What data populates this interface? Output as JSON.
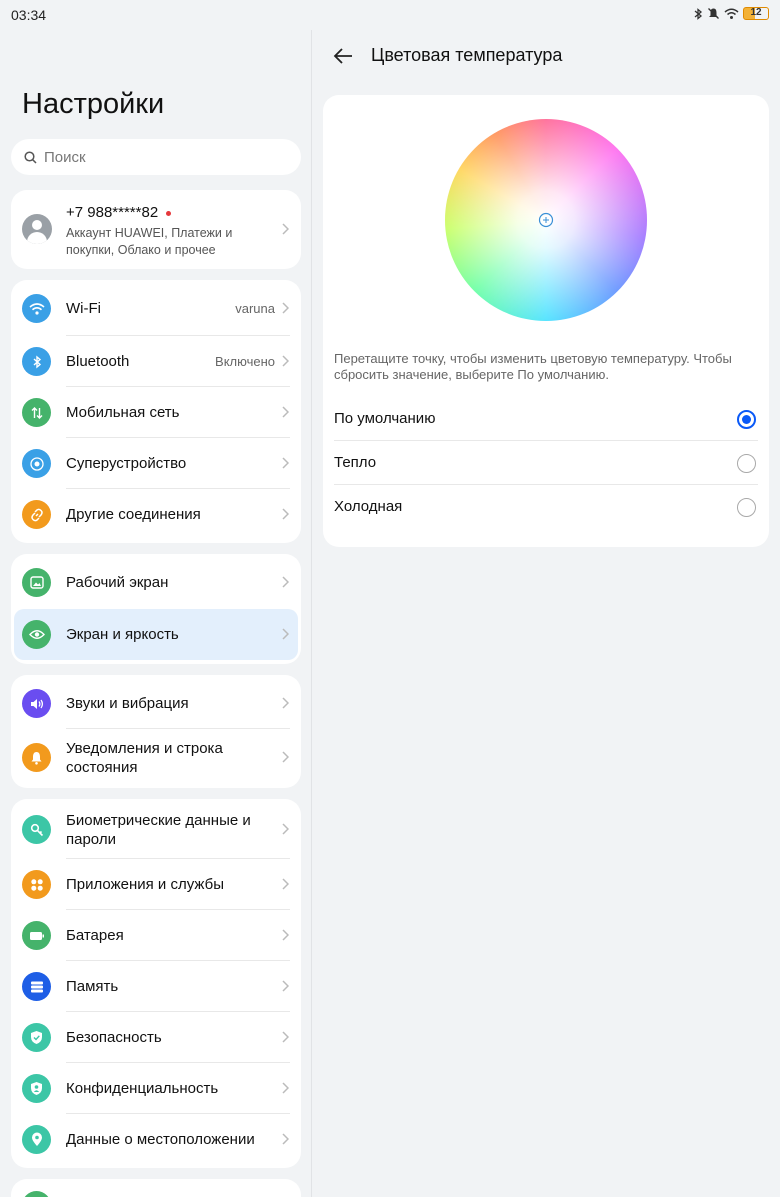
{
  "status_bar": {
    "time": "03:34",
    "battery": "12"
  },
  "left": {
    "title": "Настройки",
    "search_placeholder": "Поиск",
    "account": {
      "phone": "+7 988*****82",
      "description": "Аккаунт HUAWEI, Платежи и покупки, Облако и прочее"
    },
    "groups": [
      [
        {
          "label": "Wi-Fi",
          "value": "varuna",
          "icon": "wifi-icon",
          "color": "#3aa0e6"
        },
        {
          "label": "Bluetooth",
          "value": "Включено",
          "icon": "bluetooth-icon",
          "color": "#3aa0e6"
        },
        {
          "label": "Мобильная сеть",
          "value": "",
          "icon": "mobile-network-icon",
          "color": "#45b36b"
        },
        {
          "label": "Суперустройство",
          "value": "",
          "icon": "super-device-icon",
          "color": "#3aa0e6"
        },
        {
          "label": "Другие соединения",
          "value": "",
          "icon": "link-icon",
          "color": "#f29a1d"
        }
      ],
      [
        {
          "label": "Рабочий экран",
          "value": "",
          "icon": "home-screen-icon",
          "color": "#45b36b"
        },
        {
          "label": "Экран и яркость",
          "value": "",
          "icon": "eye-icon",
          "color": "#45b36b",
          "selected": true
        }
      ],
      [
        {
          "label": "Звуки и вибрация",
          "value": "",
          "icon": "sound-icon",
          "color": "#6a4df0"
        },
        {
          "label": "Уведомления и строка состояния",
          "value": "",
          "icon": "bell-icon",
          "color": "#f29a1d"
        }
      ],
      [
        {
          "label": "Биометрические данные и пароли",
          "value": "",
          "icon": "key-icon",
          "color": "#3cc6a6"
        },
        {
          "label": "Приложения и службы",
          "value": "",
          "icon": "apps-icon",
          "color": "#f29a1d"
        },
        {
          "label": "Батарея",
          "value": "",
          "icon": "battery-icon",
          "color": "#45b36b"
        },
        {
          "label": "Память",
          "value": "",
          "icon": "storage-icon",
          "color": "#1e5ee6"
        },
        {
          "label": "Безопасность",
          "value": "",
          "icon": "shield-icon",
          "color": "#3cc6a6"
        },
        {
          "label": "Конфиденциальность",
          "value": "",
          "icon": "privacy-icon",
          "color": "#3cc6a6"
        },
        {
          "label": "Данные о местоположении",
          "value": "",
          "icon": "location-icon",
          "color": "#3cc6a6"
        }
      ]
    ]
  },
  "right": {
    "title": "Цветовая температура",
    "hint": "Перетащите точку, чтобы изменить цветовую температуру. Чтобы сбросить значение, выберите По умолчанию.",
    "options": [
      {
        "label": "По умолчанию",
        "selected": true
      },
      {
        "label": "Тепло",
        "selected": false
      },
      {
        "label": "Холодная",
        "selected": false
      }
    ]
  }
}
